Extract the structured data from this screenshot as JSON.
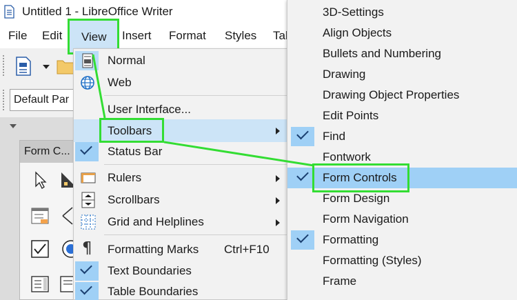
{
  "window": {
    "title": "Untitled 1 - LibreOffice Writer"
  },
  "menubar": {
    "items": [
      {
        "label": "File"
      },
      {
        "label": "Edit"
      },
      {
        "label": "View"
      },
      {
        "label": "Insert"
      },
      {
        "label": "Format"
      },
      {
        "label": "Styles"
      },
      {
        "label": "Tab"
      }
    ]
  },
  "toolbar": {
    "paragraph_style": "Default Par"
  },
  "form_panel": {
    "title": "Form C..."
  },
  "view_menu": {
    "items": [
      {
        "label": "Normal",
        "icon": "normal-view-icon"
      },
      {
        "label": "Web",
        "icon": "globe-icon"
      },
      {
        "label": "User Interface..."
      },
      {
        "label": "Toolbars",
        "submenu": true,
        "highlighted": true
      },
      {
        "label": "Status Bar",
        "checked": true
      },
      {
        "label": "Rulers",
        "icon": "ruler-icon",
        "submenu": true
      },
      {
        "label": "Scrollbars",
        "icon": "scrollbars-icon",
        "submenu": true
      },
      {
        "label": "Grid and Helplines",
        "icon": "grid-icon",
        "submenu": true
      },
      {
        "label": "Formatting Marks",
        "icon": "pilcrow-icon",
        "shortcut": "Ctrl+F10"
      },
      {
        "label": "Text Boundaries",
        "checked": true
      },
      {
        "label": "Table Boundaries",
        "checked": true
      }
    ]
  },
  "toolbars_submenu": {
    "items": [
      {
        "label": "3D-Settings"
      },
      {
        "label": "Align Objects"
      },
      {
        "label": "Bullets and Numbering"
      },
      {
        "label": "Drawing"
      },
      {
        "label": "Drawing Object Properties"
      },
      {
        "label": "Edit Points"
      },
      {
        "label": "Find",
        "checked": true
      },
      {
        "label": "Fontwork"
      },
      {
        "label": "Form Controls",
        "checked": true,
        "highlighted": true
      },
      {
        "label": "Form Design"
      },
      {
        "label": "Form Navigation"
      },
      {
        "label": "Formatting",
        "checked": true
      },
      {
        "label": "Formatting (Styles)"
      },
      {
        "label": "Frame"
      }
    ]
  },
  "colors": {
    "highlight": "#9fd0f6",
    "annotation": "#33dd33",
    "menu_bg": "#f2f2f2"
  }
}
